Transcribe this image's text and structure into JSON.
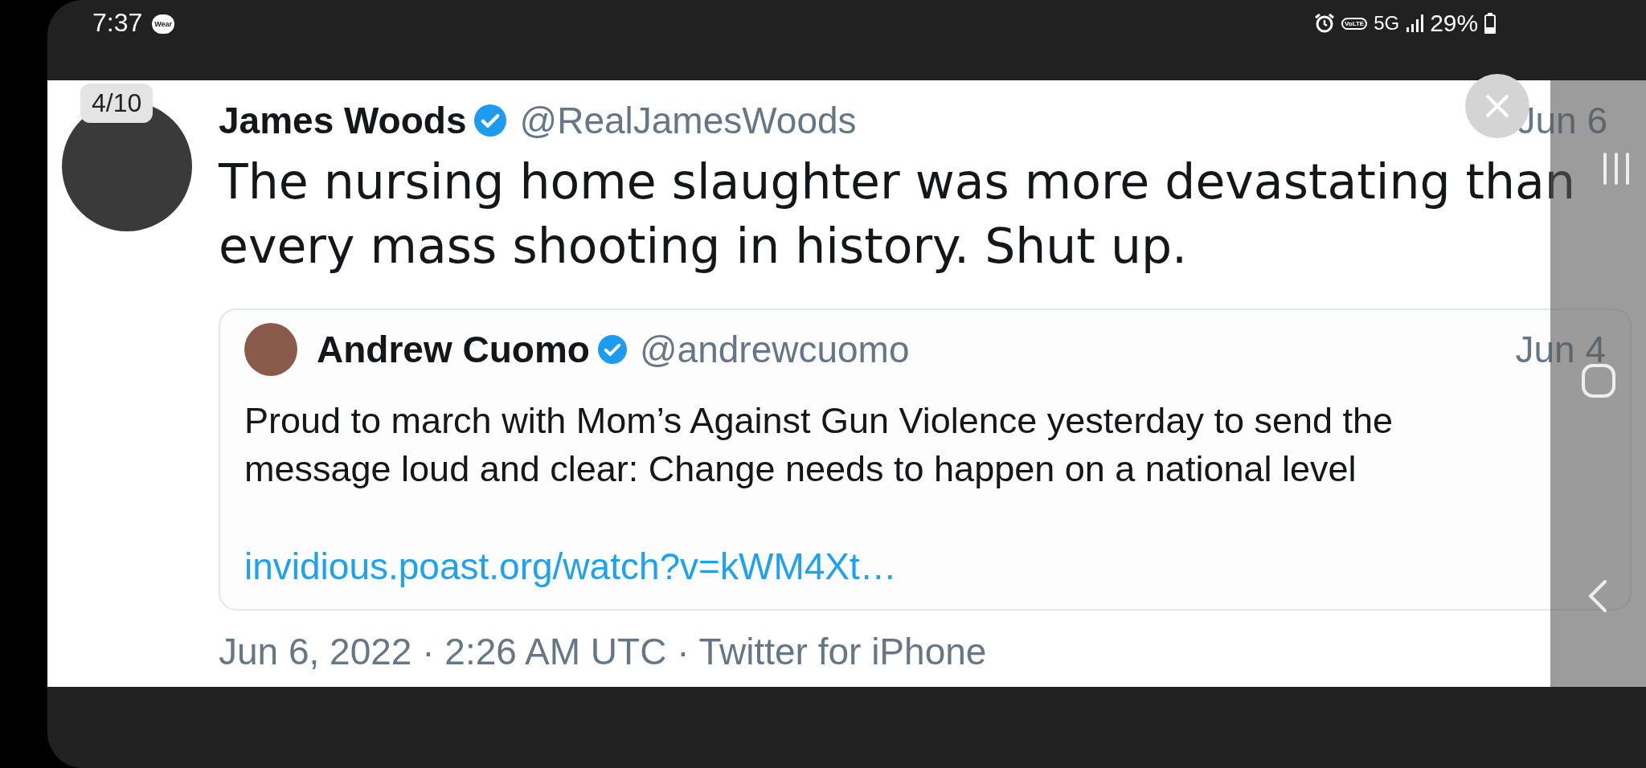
{
  "status_bar": {
    "time": "7:37",
    "badge": "Wear",
    "volte": "VoLTE",
    "network": "5G",
    "battery": "29%"
  },
  "viewer": {
    "counter": "4/10"
  },
  "tweet": {
    "author": "James Woods",
    "verified": true,
    "handle": "@RealJamesWoods",
    "date": "Jun 6",
    "text": "The nursing home slaughter was more devastating than every mass shooting in history. Shut up.",
    "quote": {
      "author": "Andrew Cuomo",
      "verified": true,
      "handle": "@andrewcuomo",
      "date": "Jun 4",
      "text": "Proud to march with Mom’s Against Gun Violence yesterday to send the message loud and clear: Change needs to happen on a national level",
      "link": "invidious.poast.org/watch?v=kWM4Xt…"
    },
    "footer": "Jun 6, 2022 · 2:26 AM UTC · Twitter for iPhone"
  }
}
